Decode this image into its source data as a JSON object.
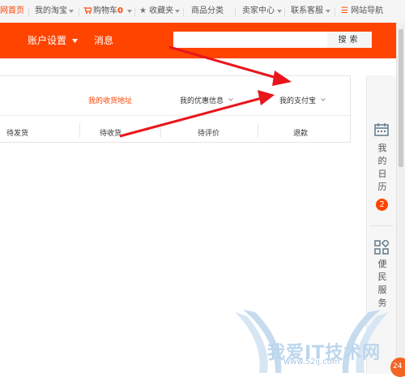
{
  "topnav": {
    "home": "网首页",
    "my_taobao": "我的淘宝",
    "cart": "购物车",
    "cart_count": "0",
    "favorites": "收藏夹",
    "categories": "商品分类",
    "seller_center": "卖家中心",
    "customer_service": "联系客服",
    "site_nav": "网站导航"
  },
  "header": {
    "account_settings": "账户设置",
    "messages": "消息",
    "search_placeholder": "",
    "search_button": "搜索"
  },
  "card": {
    "links": [
      "我的收货地址",
      "我的优惠信息",
      "我的支付宝"
    ],
    "columns": [
      "待发货",
      "待收货",
      "待评价",
      "退款"
    ]
  },
  "sidebar": {
    "calendar_label": [
      "我",
      "的",
      "日",
      "历"
    ],
    "calendar_badge": "2",
    "services_label": [
      "便",
      "民",
      "服",
      "务"
    ]
  },
  "watermark": {
    "text": "我爱IT技术网",
    "url": "www.52ij.com"
  },
  "corner_badge": "24",
  "colors": {
    "accent": "#ff4400",
    "arrow": "#e8151c",
    "watermark": "#bcd6ee"
  }
}
